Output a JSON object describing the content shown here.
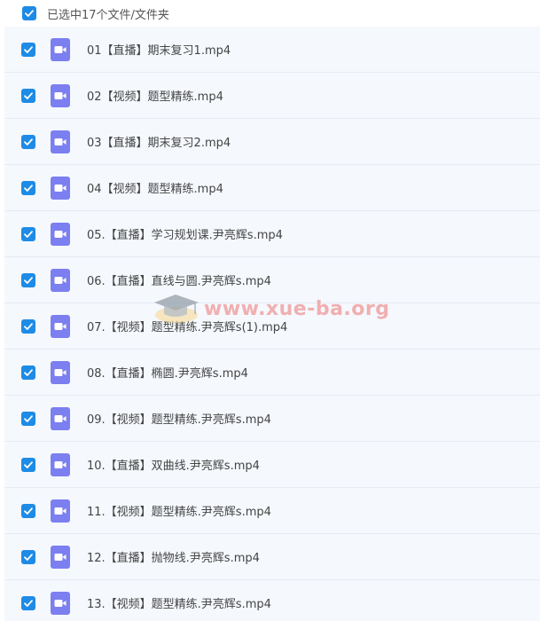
{
  "header": {
    "selection_text": "已选中17个文件/文件夹"
  },
  "files": [
    {
      "name": "01【直播】期末复习1.mp4"
    },
    {
      "name": "02【视频】题型精练.mp4"
    },
    {
      "name": "03【直播】期末复习2.mp4"
    },
    {
      "name": "04【视频】题型精练.mp4"
    },
    {
      "name": "05.【直播】学习规划课.尹亮辉s.mp4"
    },
    {
      "name": "06.【直播】直线与圆.尹亮辉s.mp4"
    },
    {
      "name": "07.【视频】题型精练.尹亮辉s(1).mp4"
    },
    {
      "name": "08.【直播】椭圆.尹亮辉s.mp4"
    },
    {
      "name": "09.【视频】题型精练.尹亮辉s.mp4"
    },
    {
      "name": "10.【直播】双曲线.尹亮辉s.mp4"
    },
    {
      "name": "11.【视频】题型精练.尹亮辉s.mp4"
    },
    {
      "name": "12.【直播】抛物线.尹亮辉s.mp4"
    },
    {
      "name": "13.【视频】题型精练.尹亮辉s.mp4"
    }
  ],
  "watermark": {
    "text": "www.xue-ba.org"
  },
  "colors": {
    "checkbox": "#1e8be6",
    "file_icon": "#7c7ff0",
    "row_background": "#f5f8fd"
  },
  "icons": {
    "checkbox": "checkmark-icon",
    "file": "video-file-icon",
    "watermark": "graduation-cap-icon"
  }
}
